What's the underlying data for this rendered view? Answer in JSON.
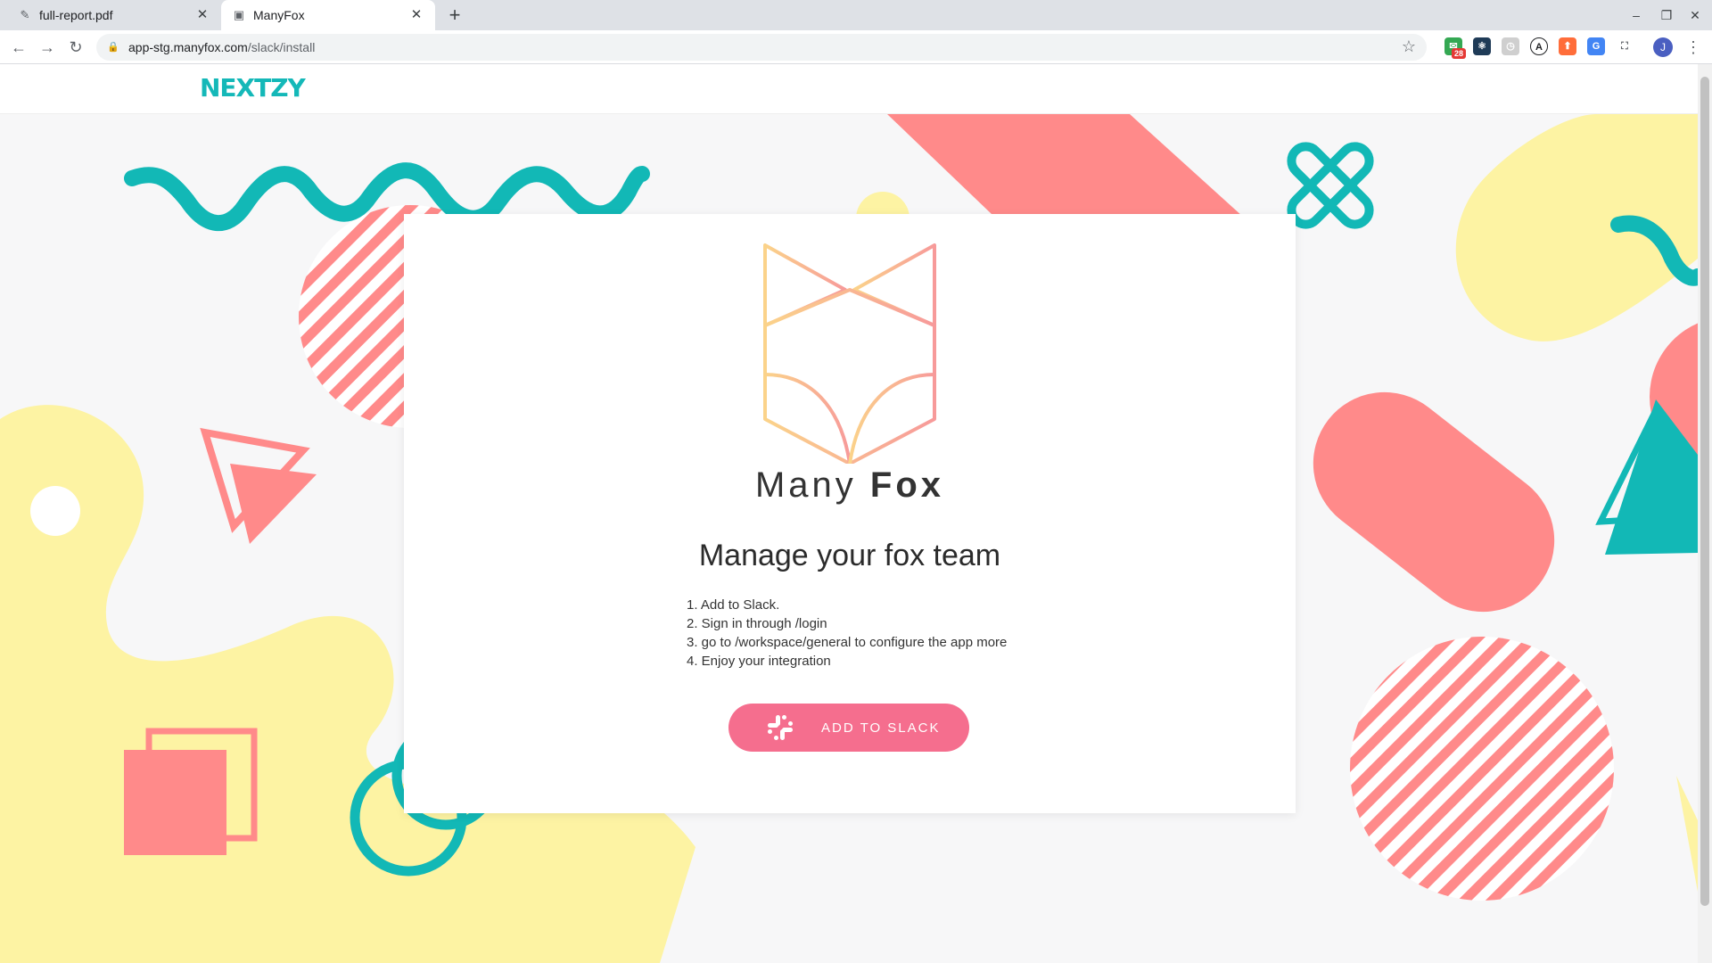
{
  "browser": {
    "tabs": [
      {
        "title": "full-report.pdf",
        "favicon": "pdf-pen-icon",
        "active": false
      },
      {
        "title": "ManyFox",
        "favicon": "monitor-icon",
        "active": true
      }
    ],
    "url_host": "app-stg.manyfox.com",
    "url_path": "/slack/install",
    "extension_badge": "28",
    "profile_initial": "J"
  },
  "page": {
    "brand": "NEXTZY",
    "logo": {
      "light": "Many",
      "bold": "Fox"
    },
    "headline": "Manage your fox team",
    "steps": [
      "1. Add to Slack.",
      "2. Sign in through /login",
      "3. go to /workspace/general to configure the app more",
      "4. Enjoy your integration"
    ],
    "cta_label": "ADD TO SLACK"
  },
  "colors": {
    "accent": "#f56e8e",
    "teal": "#12b8b6",
    "coral": "#ff8a8a",
    "yellow": "#fdf3a3"
  }
}
